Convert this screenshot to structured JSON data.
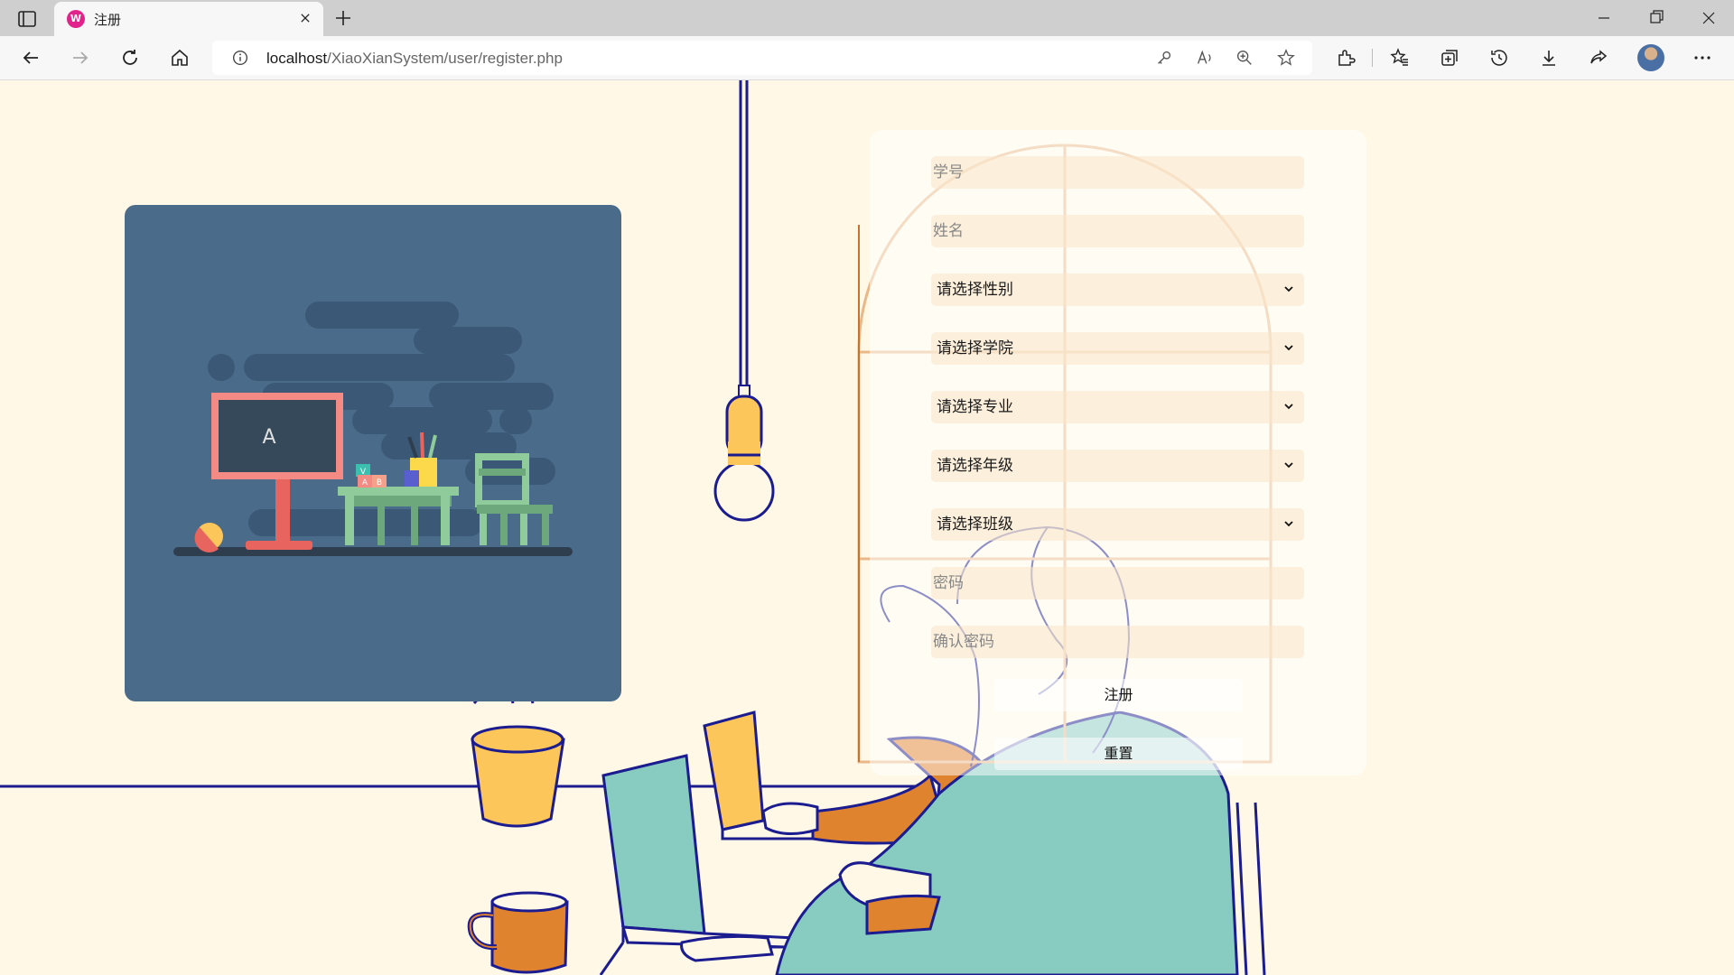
{
  "browser": {
    "tab_title": "注册",
    "favicon_text": "W",
    "url_host": "localhost",
    "url_path": "/XiaoXianSystem/user/register.php"
  },
  "form": {
    "student_id_placeholder": "学号",
    "name_placeholder": "姓名",
    "gender_select": "请选择性别",
    "college_select": "请选择学院",
    "major_select": "请选择专业",
    "grade_select": "请选择年级",
    "class_select": "请选择班级",
    "password_placeholder": "密码",
    "confirm_password_placeholder": "确认密码",
    "register_button": "注册",
    "reset_button": "重置"
  },
  "illustration": {
    "blackboard_letter": "A",
    "block_letters": [
      "V",
      "A",
      "B"
    ]
  },
  "colors": {
    "page_background": "#fff8e6",
    "illustration_panel": "#4a6b8a",
    "line_navy": "#1b1c8f",
    "accent_orange": "#e0832e",
    "accent_teal": "#88cbc0",
    "accent_yellow": "#fcc65a",
    "window_frame": "#e8b88a"
  }
}
